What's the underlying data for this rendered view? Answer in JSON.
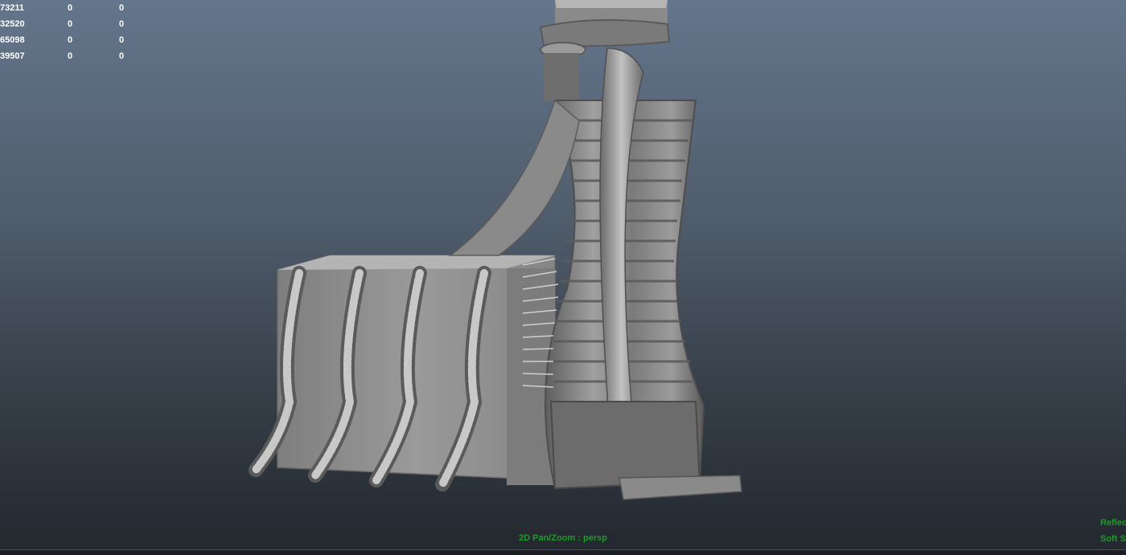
{
  "viewport": {
    "hud_rows": [
      {
        "value": "73211",
        "col2": "0",
        "col3": "0"
      },
      {
        "value": "32520",
        "col2": "0",
        "col3": "0"
      },
      {
        "value": "65098",
        "col2": "0",
        "col3": "0"
      },
      {
        "value": "39507",
        "col2": "0",
        "col3": "0"
      }
    ],
    "camera_label": "2D Pan/Zoom : persp",
    "status_right": [
      "Reflec",
      "Soft S"
    ]
  },
  "colors": {
    "background_top": "#64768c",
    "background_bottom": "#23282e",
    "hud_text": "#ffffff",
    "status_text": "#1e9a28",
    "model": "#8e8e8e"
  }
}
